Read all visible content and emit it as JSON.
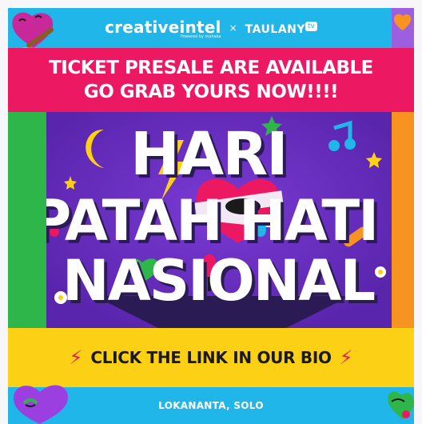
{
  "header": {
    "brand": "creativeintel",
    "brand_sub": "Powered by mahaka",
    "times": "×",
    "partner": "TAULANY",
    "partner_badge": "tv"
  },
  "banner": {
    "line1": "TICKET PRESALE ARE AVAILABLE",
    "line2": "GO GRAB YOURS NOW!!!!"
  },
  "art": {
    "title_line1": "HARI",
    "title_line2": "PATAH HATI",
    "title_line3": "NASIONAL"
  },
  "cta": {
    "text": "CLICK THE LINK IN OUR BIO",
    "bolt_icon": "⚡"
  },
  "footer": {
    "location": "LOKANANTA, SOLO"
  },
  "colors": {
    "cyan": "#21b6e9",
    "pink": "#ed1862",
    "purple": "#6a2fc2",
    "yellow": "#fcd015",
    "green": "#2fb64b",
    "orange": "#f79321"
  }
}
